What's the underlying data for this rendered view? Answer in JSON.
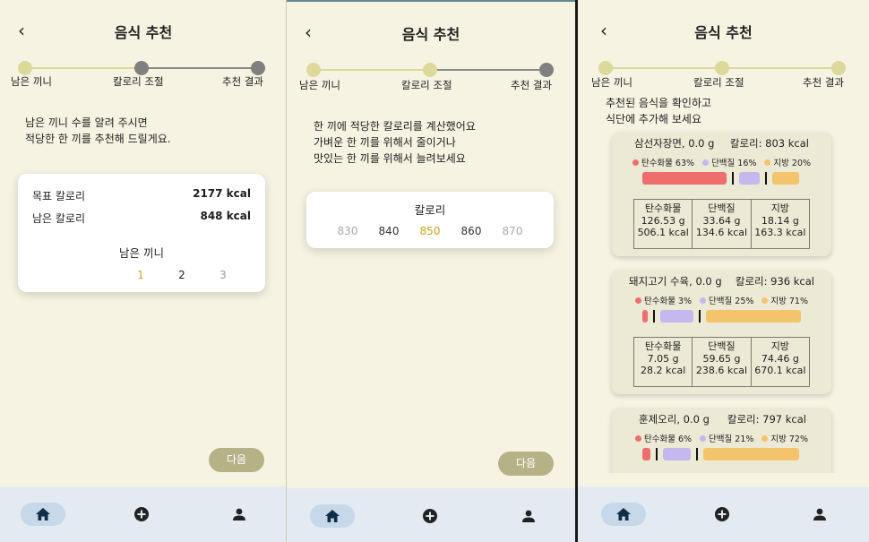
{
  "colors": {
    "background": "#f6f3e3",
    "accent": "#d4a017",
    "step_active": "#dcd99a",
    "step_inactive": "#808080",
    "button": "#b5b287",
    "nav": "#e3eaf1",
    "carb": "#ee6e6e",
    "protein": "#c5b8ee",
    "fat": "#f4c46c"
  },
  "title": "음식 추천",
  "steps": [
    "남은 끼니",
    "칼로리 조절",
    "추천 결과"
  ],
  "screen1": {
    "intro": [
      "남은 끼니 수를 알려 주시면",
      "적당한 한 끼를 추천해 드릴게요."
    ],
    "target_label": "목표 칼로리",
    "target_value": "2177 kcal",
    "remaining_label": "남은 칼로리",
    "remaining_value": "848 kcal",
    "meals_label": "남은 끼니",
    "meal_options": [
      "1",
      "2",
      "3"
    ],
    "selected_meal": "1",
    "next": "다음"
  },
  "screen2": {
    "intro": [
      "한 끼에 적당한 칼로리를 계산했어요",
      "가벼운 한 끼를 위해서 줄이거나",
      "맛있는 한 끼를 위해서 늘려보세요"
    ],
    "picker_label": "칼로리",
    "options": [
      "830",
      "840",
      "850",
      "860",
      "870"
    ],
    "selected": "850",
    "next": "다음"
  },
  "screen3": {
    "intro": [
      "추천된 음식을 확인하고",
      "식단에 추가해 보세요"
    ],
    "foods": [
      {
        "name": "삼선자장면, 0.0 g",
        "kcal": "칼로리: 803 kcal",
        "legend": [
          "탄수화물 63%",
          "단백질 16%",
          "지방 20%"
        ],
        "ratios": [
          63,
          16,
          20
        ],
        "headers": [
          "탄수화물",
          "단백질",
          "지방"
        ],
        "grams": [
          "126.53 g",
          "33.64 g",
          "18.14 g"
        ],
        "kcals": [
          "506.1 kcal",
          "134.6 kcal",
          "163.3 kcal"
        ]
      },
      {
        "name": "돼지고기 수육, 0.0 g",
        "kcal": "칼로리: 936 kcal",
        "legend": [
          "탄수화물 3%",
          "단백질 25%",
          "지방 71%"
        ],
        "ratios": [
          3,
          25,
          71
        ],
        "headers": [
          "탄수화물",
          "단백질",
          "지방"
        ],
        "grams": [
          "7.05 g",
          "59.65 g",
          "74.46 g"
        ],
        "kcals": [
          "28.2 kcal",
          "238.6 kcal",
          "670.1 kcal"
        ]
      },
      {
        "name": "훈제오리, 0.0 g",
        "kcal": "칼로리: 797 kcal",
        "legend": [
          "탄수화물 6%",
          "단백질 21%",
          "지방 72%"
        ],
        "ratios": [
          6,
          21,
          72
        ]
      }
    ]
  },
  "nav": [
    "home-icon",
    "add-icon",
    "user-icon"
  ]
}
